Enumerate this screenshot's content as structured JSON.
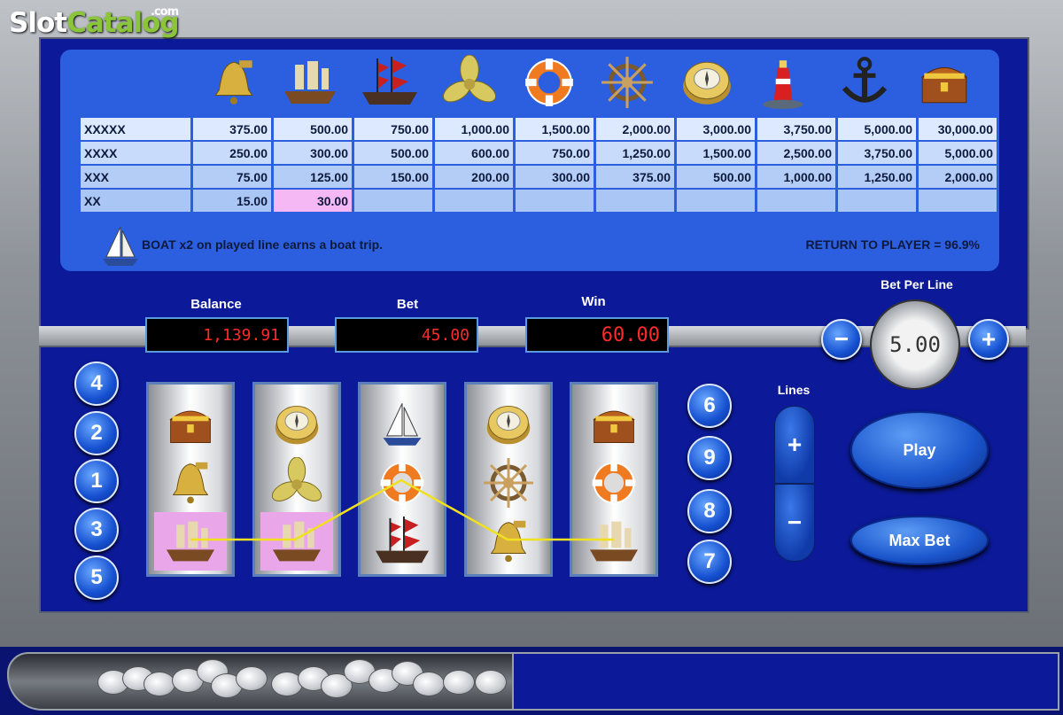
{
  "logo": {
    "main": "Slot",
    "accent": "Catalog",
    "suffix": ".com"
  },
  "paytable": {
    "symbols": [
      "bell-icon",
      "galleon-icon",
      "pirate-ship-icon",
      "propeller-icon",
      "life-ring-icon",
      "ship-wheel-icon",
      "compass-icon",
      "lighthouse-icon",
      "anchor-icon",
      "treasure-chest-icon"
    ],
    "rows": [
      {
        "label": "XXXXX",
        "values": [
          "375.00",
          "500.00",
          "750.00",
          "1,000.00",
          "1,500.00",
          "2,000.00",
          "3,000.00",
          "3,750.00",
          "5,000.00",
          "30,000.00"
        ]
      },
      {
        "label": "XXXX",
        "values": [
          "250.00",
          "300.00",
          "500.00",
          "600.00",
          "750.00",
          "1,250.00",
          "1,500.00",
          "2,500.00",
          "3,750.00",
          "5,000.00"
        ]
      },
      {
        "label": "XXX",
        "values": [
          "75.00",
          "125.00",
          "150.00",
          "200.00",
          "300.00",
          "375.00",
          "500.00",
          "1,000.00",
          "1,250.00",
          "2,000.00"
        ]
      },
      {
        "label": "XX",
        "values": [
          "15.00",
          "30.00",
          "",
          "",
          "",
          "",
          "",
          "",
          "",
          ""
        ]
      }
    ],
    "boat_note": "BOAT x2 on played line earns a boat trip.",
    "rtp": "RETURN TO PLAYER = 96.9%"
  },
  "meters": {
    "balance_label": "Balance",
    "balance": "1,139.91",
    "bet_label": "Bet",
    "bet": "45.00",
    "win_label": "Win",
    "win": "60.00"
  },
  "bet_per_line": {
    "label": "Bet Per Line",
    "value": "5.00",
    "minus": "−",
    "plus": "+"
  },
  "left_lines": [
    "4",
    "2",
    "1",
    "3",
    "5"
  ],
  "right_lines": [
    "6",
    "9",
    "8",
    "7"
  ],
  "lines": {
    "label": "Lines",
    "plus": "+",
    "minus": "−"
  },
  "buttons": {
    "play": "Play",
    "max_bet": "Max Bet"
  },
  "reels": [
    [
      "treasure-chest-icon",
      "bell-icon",
      "galleon-icon"
    ],
    [
      "compass-icon",
      "propeller-icon",
      "galleon-icon"
    ],
    [
      "sailboat-icon",
      "life-ring-icon",
      "pirate-ship-icon"
    ],
    [
      "compass-icon",
      "ship-wheel-icon",
      "bell-icon"
    ],
    [
      "treasure-chest-icon",
      "life-ring-icon",
      "galleon-icon"
    ]
  ],
  "colors": {
    "win_highlight": "#e9a6e9",
    "payline": "#f0e020",
    "meter_text": "#ff2a2a"
  }
}
